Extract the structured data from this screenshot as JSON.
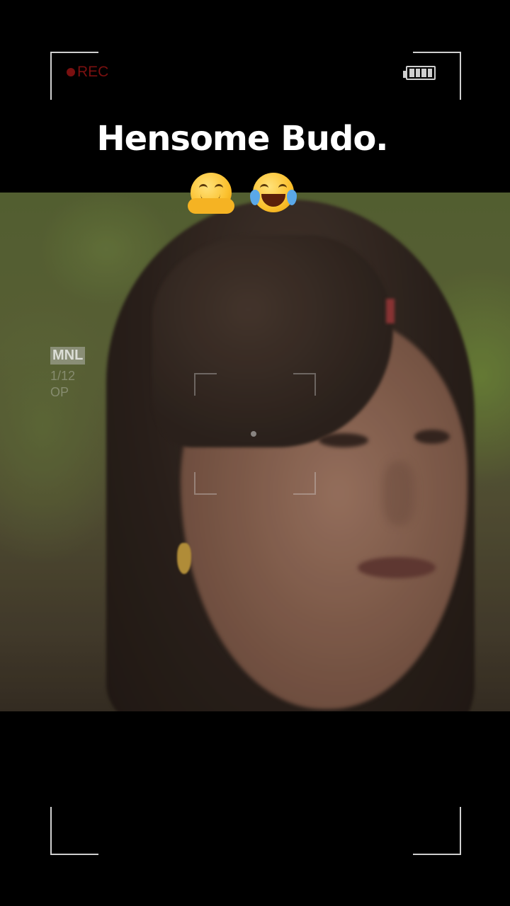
{
  "viewfinder": {
    "rec_label": "REC",
    "battery_level": 1.0,
    "mode_badge": "MNL",
    "frame_counter": "1/12",
    "op_label": "OP"
  },
  "caption": {
    "text": "Hensome Budo.",
    "emojis": [
      "hugging-face",
      "face-with-tears-of-joy"
    ]
  },
  "colors": {
    "background": "#000000",
    "rec": "#7a1010",
    "overlay": "#cfcfcf",
    "caption": "#ffffff"
  }
}
